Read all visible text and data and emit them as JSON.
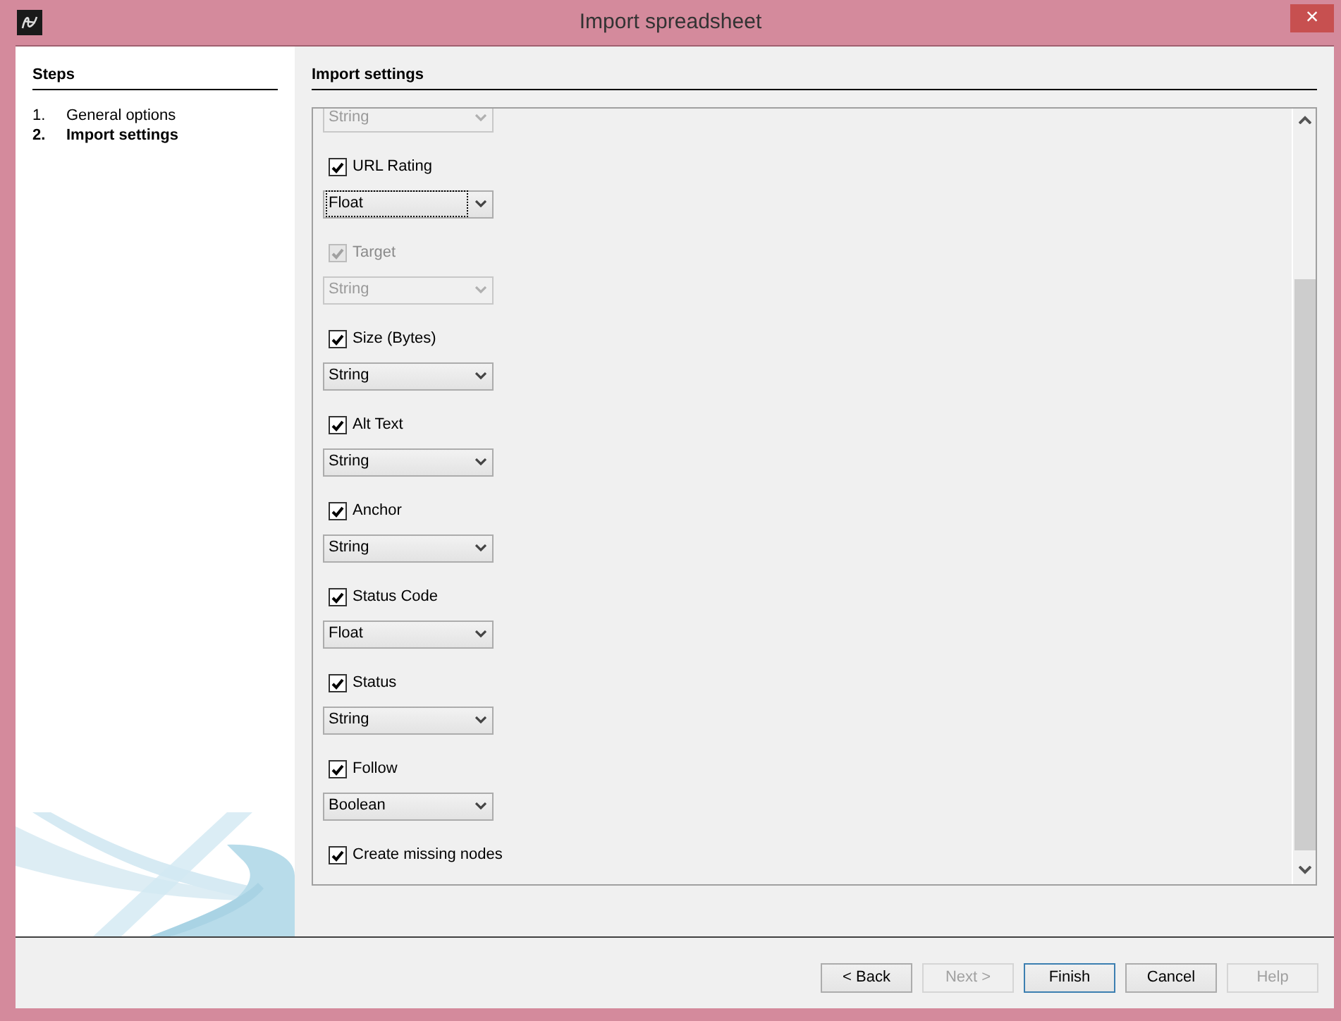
{
  "window": {
    "title": "Import spreadsheet",
    "close": "×"
  },
  "steps": {
    "heading": "Steps",
    "items": [
      {
        "number": "1.",
        "label": "General options",
        "selected": false
      },
      {
        "number": "2.",
        "label": "Import settings",
        "selected": true
      }
    ]
  },
  "settings": {
    "heading": "Import settings",
    "fields": [
      {
        "kind": "select",
        "type": "String",
        "disabled": true
      },
      {
        "kind": "column",
        "label": "URL Rating",
        "checked": true,
        "disabled": false,
        "type": "Float",
        "focused": true
      },
      {
        "kind": "column",
        "label": "Target",
        "checked": true,
        "disabled": true,
        "type": "String"
      },
      {
        "kind": "column",
        "label": "Size (Bytes)",
        "checked": true,
        "disabled": false,
        "type": "String"
      },
      {
        "kind": "column",
        "label": "Alt Text",
        "checked": true,
        "disabled": false,
        "type": "String"
      },
      {
        "kind": "column",
        "label": "Anchor",
        "checked": true,
        "disabled": false,
        "type": "String"
      },
      {
        "kind": "column",
        "label": "Status Code",
        "checked": true,
        "disabled": false,
        "type": "Float"
      },
      {
        "kind": "column",
        "label": "Status",
        "checked": true,
        "disabled": false,
        "type": "String"
      },
      {
        "kind": "column",
        "label": "Follow",
        "checked": true,
        "disabled": false,
        "type": "Boolean"
      },
      {
        "kind": "checkbox",
        "label": "Create missing nodes",
        "checked": true,
        "disabled": false
      }
    ]
  },
  "buttons": [
    {
      "label": "< Back",
      "disabled": false,
      "default": false
    },
    {
      "label": "Next >",
      "disabled": true,
      "default": false
    },
    {
      "label": "Finish",
      "disabled": false,
      "default": true
    },
    {
      "label": "Cancel",
      "disabled": false,
      "default": false
    },
    {
      "label": "Help",
      "disabled": true,
      "default": false
    }
  ]
}
